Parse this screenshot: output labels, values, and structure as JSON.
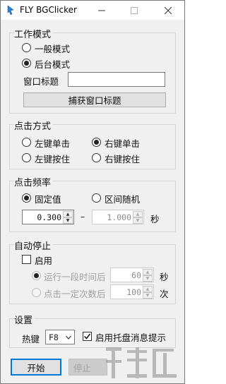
{
  "window": {
    "title": "FLY BGClicker",
    "controls": {
      "minimize": "—",
      "maximize": "☐",
      "close": "✕"
    }
  },
  "work_mode": {
    "label": "工作模式",
    "options": [
      {
        "label": "一般模式",
        "selected": false
      },
      {
        "label": "后台模式",
        "selected": true
      }
    ],
    "window_title_label": "窗口标题",
    "window_title_value": "",
    "capture_button": "捕获窗口标题"
  },
  "click_method": {
    "label": "点击方式",
    "options": [
      {
        "label": "左键单击",
        "selected": false
      },
      {
        "label": "右键单击",
        "selected": true
      },
      {
        "label": "左键按住",
        "selected": false
      },
      {
        "label": "右键按住",
        "selected": false
      }
    ]
  },
  "click_frequency": {
    "label": "点击频率",
    "fixed_label": "固定值",
    "fixed_selected": true,
    "random_label": "区间随机",
    "random_selected": false,
    "min_value": "0.300",
    "separator": "–",
    "max_value": "1.000",
    "unit": "秒"
  },
  "auto_stop": {
    "label": "自动停止",
    "enable_label": "启用",
    "enabled": false,
    "time_option_label": "运行一段时间后",
    "time_value": "60",
    "time_unit": "秒",
    "count_option_label": "点击一定次数后",
    "count_value": "100",
    "count_unit": "次"
  },
  "settings": {
    "label": "设置",
    "hotkey_label": "热键",
    "hotkey_value": "F8",
    "tray_label": "启用托盘消息提示",
    "tray_checked": true
  },
  "footer": {
    "start_button": "开始",
    "stop_button": "停止"
  },
  "colors": {
    "accent": "#0078d7",
    "icon_blue": "#2d7fd3"
  }
}
